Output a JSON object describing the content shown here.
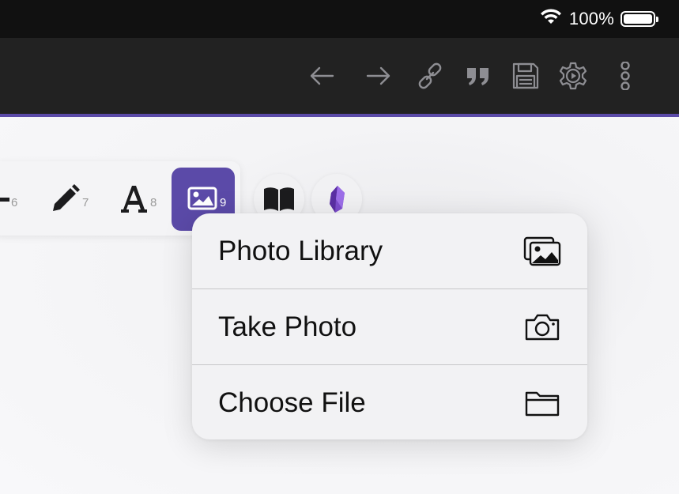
{
  "status_bar": {
    "battery_percent": "100%",
    "battery_level": 1.0,
    "wifi": "wifi-full"
  },
  "toolbar": {
    "buttons": [
      {
        "name": "back-icon"
      },
      {
        "name": "forward-icon"
      },
      {
        "name": "link-icon"
      },
      {
        "name": "quote-icon"
      },
      {
        "name": "save-icon"
      },
      {
        "name": "settings-play-icon"
      },
      {
        "name": "more-vertical-icon"
      }
    ]
  },
  "markdown_toolbar": {
    "items": [
      {
        "name": "horizontal-rule",
        "number": "6"
      },
      {
        "name": "pencil",
        "number": "7"
      },
      {
        "name": "text-format",
        "number": "8"
      },
      {
        "name": "image",
        "number": "9",
        "active": true
      }
    ],
    "extra_buttons": [
      "book-icon",
      "obsidian-icon"
    ]
  },
  "menu": {
    "items": [
      {
        "label": "Photo Library",
        "icon": "photo-library-icon"
      },
      {
        "label": "Take Photo",
        "icon": "camera-icon"
      },
      {
        "label": "Choose File",
        "icon": "folder-icon"
      }
    ]
  },
  "colors": {
    "accent": "#5b4aa8",
    "toolbar_bg": "#222222",
    "statusbar_bg": "#111111",
    "icon_gray": "#8e8e93"
  }
}
